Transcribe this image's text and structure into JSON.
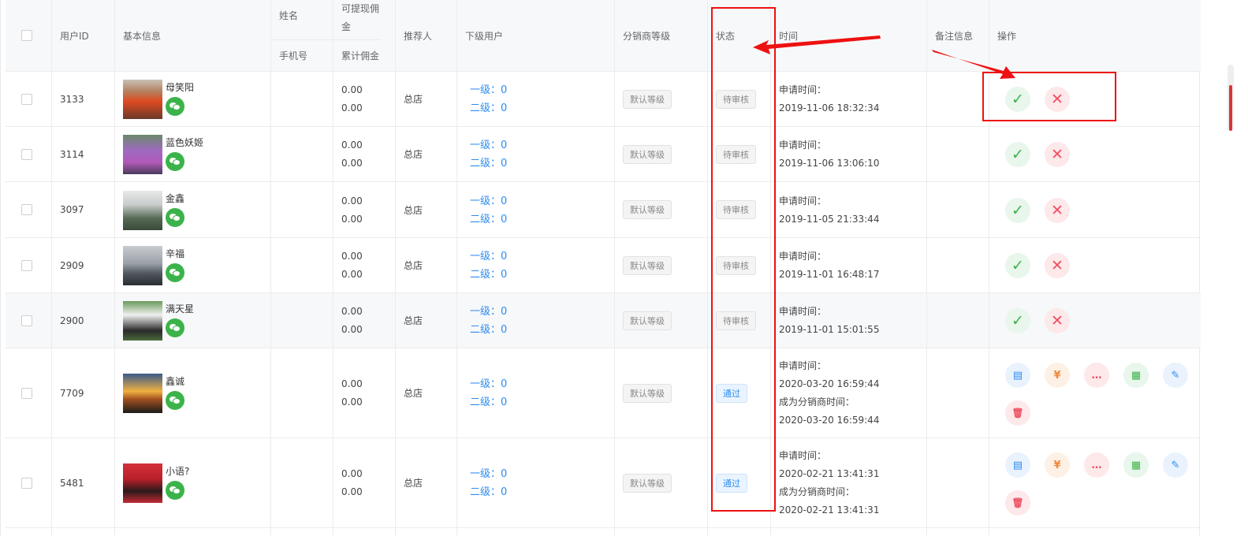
{
  "headers": {
    "user_id": "用户ID",
    "basic_info": "基本信息",
    "name": "姓名",
    "phone": "手机号",
    "withdrawable": "可提现佣金",
    "total_commission": "累计佣金",
    "referrer": "推荐人",
    "subordinates": "下级用户",
    "level": "分销商等级",
    "status": "状态",
    "time": "时间",
    "remark": "备注信息",
    "actions": "操作"
  },
  "rows": [
    {
      "id": "3133",
      "name": "母笑阳",
      "withdrawable": "0.00",
      "total": "0.00",
      "referrer": "总店",
      "level1": "一级：0",
      "level2": "二级：0",
      "level": "默认等级",
      "status": "待审核",
      "pass": false,
      "time_label1": "申请时间：",
      "time1": "2019-11-06 18:32:34",
      "avatar_color": "#9a5a3a"
    },
    {
      "id": "3114",
      "name": "蓝色妖姬",
      "withdrawable": "0.00",
      "total": "0.00",
      "referrer": "总店",
      "level1": "一级：0",
      "level2": "二级：0",
      "level": "默认等级",
      "status": "待审核",
      "pass": false,
      "time_label1": "申请时间：",
      "time1": "2019-11-06 13:06:10",
      "avatar_color": "#8a4a9a"
    },
    {
      "id": "3097",
      "name": "金鑫",
      "withdrawable": "0.00",
      "total": "0.00",
      "referrer": "总店",
      "level1": "一级：0",
      "level2": "二级：0",
      "level": "默认等级",
      "status": "待审核",
      "pass": false,
      "time_label1": "申请时间：",
      "time1": "2019-11-05 21:33:44",
      "avatar_color": "#5a6a5a"
    },
    {
      "id": "2909",
      "name": "辛福",
      "withdrawable": "0.00",
      "total": "0.00",
      "referrer": "总店",
      "level1": "一级：0",
      "level2": "二级：0",
      "level": "默认等级",
      "status": "待审核",
      "pass": false,
      "time_label1": "申请时间：",
      "time1": "2019-11-01 16:48:17",
      "avatar_color": "#8a8f96"
    },
    {
      "id": "2900",
      "name": "满天星",
      "withdrawable": "0.00",
      "total": "0.00",
      "referrer": "总店",
      "level1": "一级：0",
      "level2": "二级：0",
      "level": "默认等级",
      "status": "待审核",
      "pass": false,
      "time_label1": "申请时间：",
      "time1": "2019-11-01 15:01:55",
      "avatar_color": "#5a7a4a"
    },
    {
      "id": "7709",
      "name": "鑫诚",
      "withdrawable": "0.00",
      "total": "0.00",
      "referrer": "总店",
      "level1": "一级：0",
      "level2": "二级：0",
      "level": "默认等级",
      "status": "通过",
      "pass": true,
      "time_label1": "申请时间：",
      "time1": "2020-03-20 16:59:44",
      "time_label2": "成为分销商时间：",
      "time2": "2020-03-20 16:59:44",
      "avatar_color": "#c98a3a"
    },
    {
      "id": "5481",
      "name": "小语?",
      "withdrawable": "0.00",
      "total": "0.00",
      "referrer": "总店",
      "level1": "一级：0",
      "level2": "二级：0",
      "level": "默认等级",
      "status": "通过",
      "pass": true,
      "time_label1": "申请时间：",
      "time1": "2020-02-21 13:41:31",
      "time_label2": "成为分销商时间：",
      "time2": "2020-02-21 13:41:31",
      "avatar_color": "#c2232f"
    }
  ],
  "icons": {
    "approve": "✓",
    "reject": "✕",
    "detail": "▤",
    "commission": "¥",
    "message": "…",
    "qrcode": "▦",
    "edit": "✎",
    "delete": "🗑"
  }
}
